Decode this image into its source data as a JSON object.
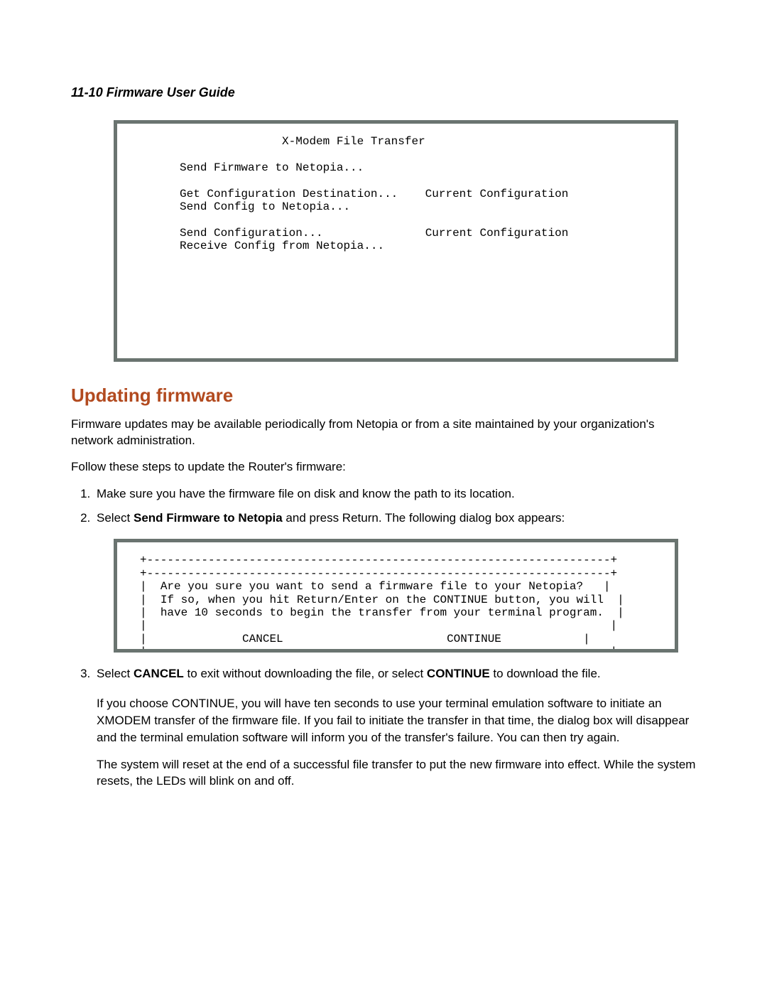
{
  "header": "11-10  Firmware User Guide",
  "terminal1": {
    "title": "X-Modem File Transfer",
    "row_sendfw": "Send Firmware to Netopia...",
    "row_getconf_left": "Get Configuration Destination...",
    "row_getconf_right": "Current Configuration",
    "row_sendconf": "Send Config to Netopia...",
    "row_sendconf2_left": "Send Configuration...",
    "row_sendconf2_right": "Current Configuration",
    "row_recvconf": "Receive Config from Netopia..."
  },
  "heading": "Updating firmware",
  "p1": "Firmware updates may be available periodically from Netopia or from a site maintained by your organization's network administration.",
  "p2": "Follow these steps to update the Router's firmware:",
  "step1": "Make sure you have the firmware file on disk and know the path to its location.",
  "step2_a": "Select ",
  "step2_bold": "Send Firmware to Netopia",
  "step2_b": " and press Return. The following dialog box appears:",
  "terminal2": {
    "line1": "Are you sure you want to send a firmware file to your Netopia?",
    "line2": "If so, when you hit Return/Enter on the CONTINUE button, you will",
    "line3": "have 10 seconds to begin the transfer from your terminal program.",
    "cancel": "CANCEL",
    "continue": "CONTINUE"
  },
  "step3_a": "Select ",
  "step3_bold1": "CANCEL",
  "step3_b": " to exit without downloading the file, or select ",
  "step3_bold2": "CONTINUE",
  "step3_c": " to download the file.",
  "step3_p1": "If you choose CONTINUE, you will have ten seconds to use your terminal emulation software to initiate an XMODEM transfer of the firmware file. If you fail to initiate the transfer in that time, the dialog box will disappear and the terminal emulation software will inform you of the transfer's failure. You can then try again.",
  "step3_p2": "The system will reset at the end of a successful file transfer to put the new firmware into effect. While the system resets, the LEDs will blink on and off."
}
